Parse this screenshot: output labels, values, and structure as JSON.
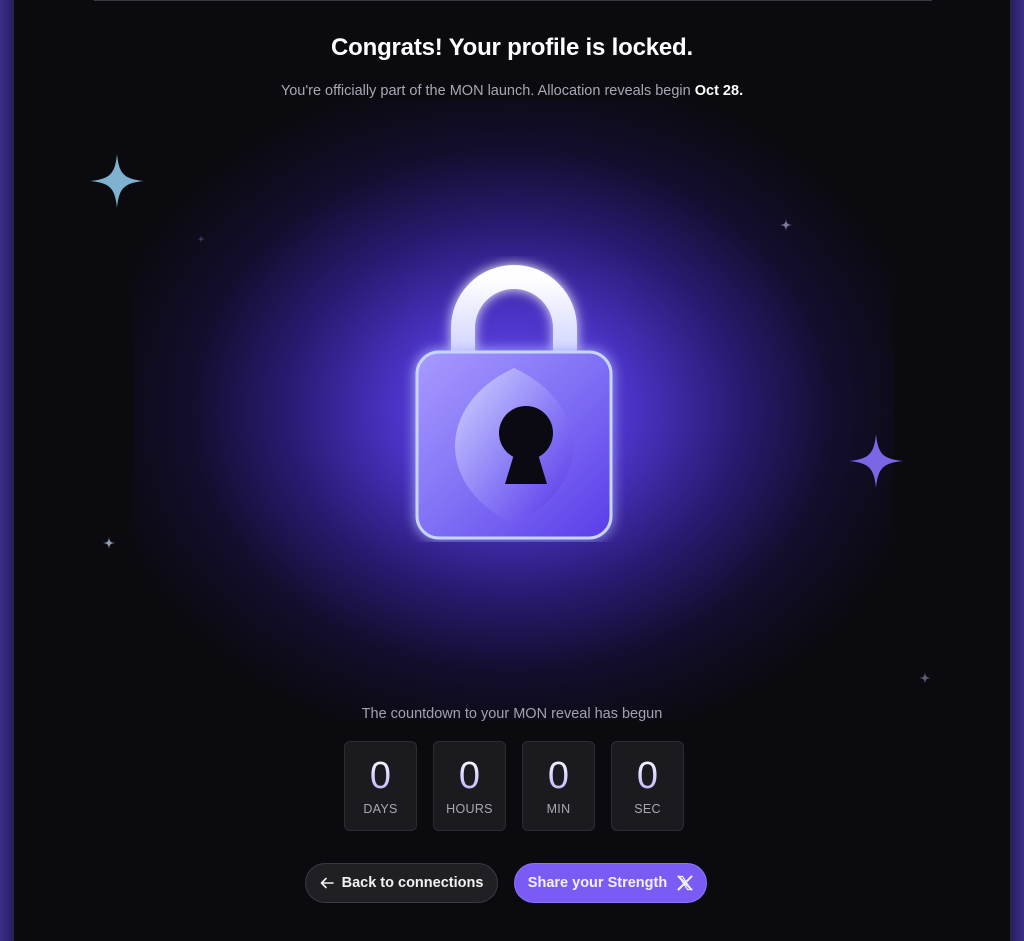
{
  "header": {
    "title": "Congrats! Your profile is locked.",
    "subtitle_text": "You're officially part of the MON launch. Allocation reveals begin ",
    "subtitle_date": "Oct 28."
  },
  "hero": {
    "icon": "padlock-icon",
    "accent": "#6c50ff"
  },
  "countdown": {
    "label": "The countdown to your MON reveal has begun",
    "units": [
      {
        "value": "0",
        "label": "DAYS"
      },
      {
        "value": "0",
        "label": "HOURS"
      },
      {
        "value": "0",
        "label": "MIN"
      },
      {
        "value": "0",
        "label": "SEC"
      }
    ]
  },
  "actions": {
    "back_label": "Back to connections",
    "back_icon": "arrow-left-icon",
    "share_label": "Share your Strength",
    "share_icon": "x-logo-icon",
    "share_color": "#7a5cf5"
  }
}
